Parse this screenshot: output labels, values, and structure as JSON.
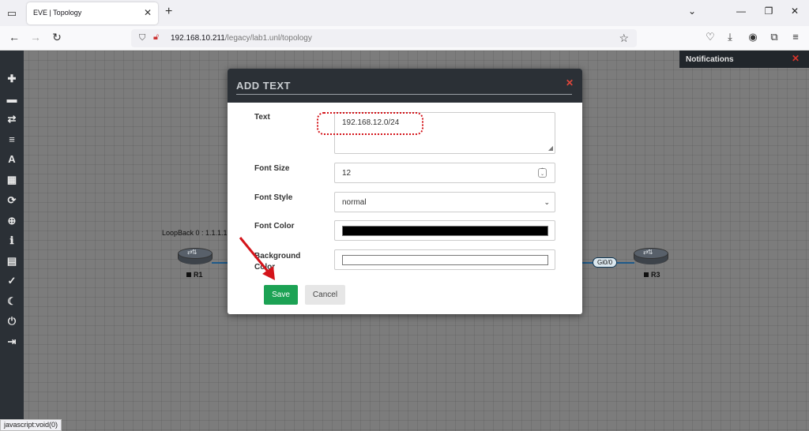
{
  "browser": {
    "tab_title": "EVE | Topology",
    "url_host": "192.168.10.211",
    "url_path": "/legacy/lab1.unl/topology",
    "status_text": "javascript:void(0)"
  },
  "notifications": {
    "title": "Notifications"
  },
  "topology": {
    "loopback_label": "LoopBack 0 : 1.1.1.1",
    "node_r1": "R1",
    "node_r3": "R3",
    "iface_label": "Gi0/0"
  },
  "dialog": {
    "title": "ADD TEXT",
    "text_label": "Text",
    "text_value": "192.168.12.0/24",
    "font_size_label": "Font Size",
    "font_size_value": "12",
    "font_style_label": "Font Style",
    "font_style_value": "normal",
    "font_color_label": "Font Color",
    "font_color_value": "#000000",
    "bg_color_label": "Background Color",
    "bg_color_value": "#ffffff",
    "save_label": "Save",
    "cancel_label": "Cancel"
  },
  "colors": {
    "save_button": "#1ca254",
    "annotation_red": "#d4141a",
    "sidebar_bg": "#2b3036"
  }
}
